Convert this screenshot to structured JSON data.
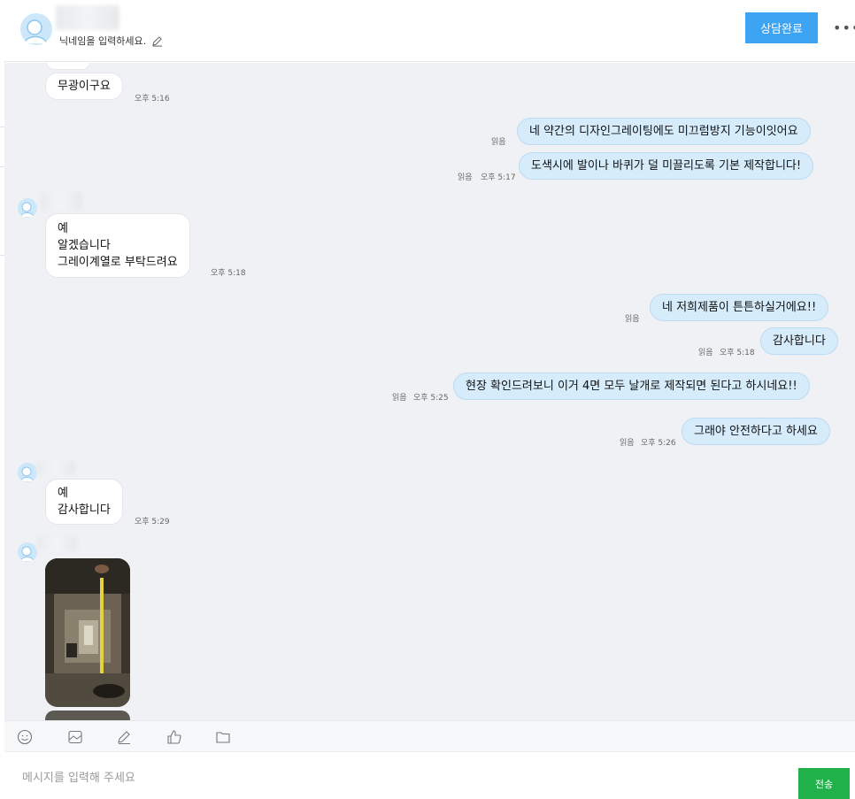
{
  "header": {
    "nickname_placeholder": "닉네임을 입력하세요.",
    "complete_button": "상담완료",
    "more_label": "•••"
  },
  "messages": [
    {
      "side": "in",
      "text": "무광이구요",
      "time": "오후 5:16"
    },
    {
      "side": "out",
      "text": "네 약간의 디자인그레이팅에도 미끄럼방지 기능이잇어요",
      "read": "읽음"
    },
    {
      "side": "out",
      "text": "도색시에 발이나 바퀴가 덜 미끌리도록 기본 제작합니다!",
      "read": "읽음",
      "time": "오후 5:17"
    },
    {
      "side": "in",
      "text": "예\n알겠습니다\n그레이계열로 부탁드려요",
      "time": "오후 5:18"
    },
    {
      "side": "out",
      "text": "네 저희제품이 튼튼하실거에요!!",
      "read": "읽음"
    },
    {
      "side": "out",
      "text": "감사합니다",
      "read": "읽음",
      "time": "오후 5:18"
    },
    {
      "side": "out",
      "text": "현장 확인드려보니 이거 4면 모두 날개로 제작되면 된다고 하시네요!!",
      "read": "읽음",
      "time": "오후 5:25"
    },
    {
      "side": "out",
      "text": "그래야 안전하다고 하세요",
      "read": "읽음",
      "time": "오후 5:26"
    },
    {
      "side": "in",
      "text": "예\n감사합니다",
      "time": "오후 5:29"
    }
  ],
  "toolbar": {
    "icons": [
      "emoji-icon",
      "image-icon",
      "pen-icon",
      "thumbs-up-icon",
      "folder-icon"
    ]
  },
  "compose": {
    "placeholder": "메시지를 입력해 주세요",
    "send_label": "전송"
  },
  "colors": {
    "accent": "#3da3f3",
    "send": "#20b14b",
    "outgoing_bubble": "#d6ecfb",
    "chat_background": "#eff1f5"
  }
}
